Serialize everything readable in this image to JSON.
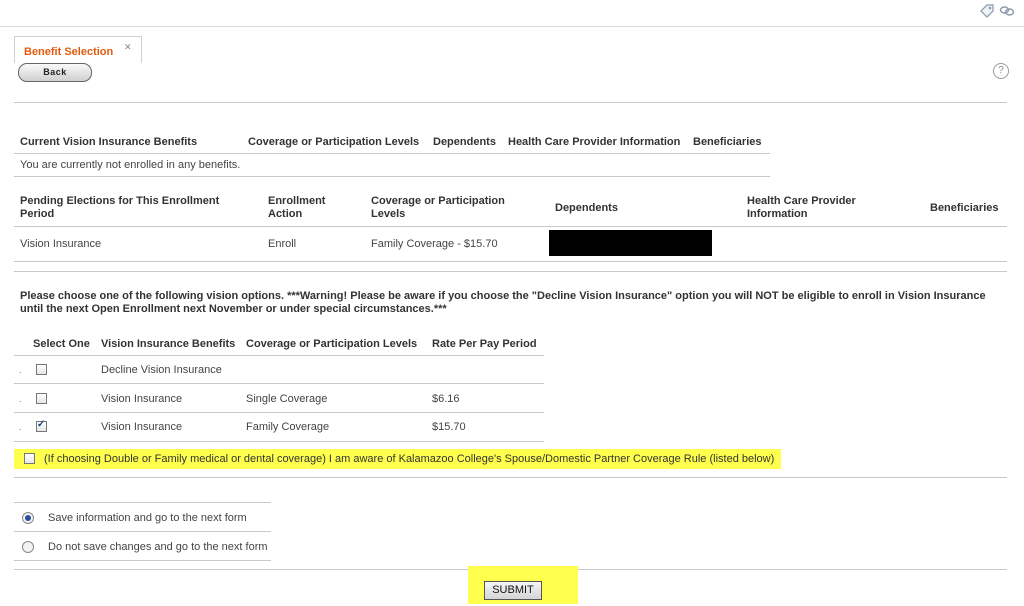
{
  "tab": {
    "title": "Benefit Selection"
  },
  "toolbar": {
    "back_label": "Back",
    "help_label": "?"
  },
  "current": {
    "headers": [
      "Current Vision Insurance Benefits",
      "Coverage or Participation Levels",
      "Dependents",
      "Health Care Provider Information",
      "Beneficiaries"
    ],
    "message": "You are currently not enrolled in any benefits."
  },
  "pending": {
    "headers": [
      "Pending Elections for This Enrollment Period",
      "Enrollment Action",
      "Coverage or Participation Levels",
      "Dependents",
      "Health Care Provider Information",
      "Beneficiaries"
    ],
    "row": {
      "benefit": "Vision Insurance",
      "action": "Enroll",
      "coverage": "Family Coverage - $15.70"
    }
  },
  "instructions": "Please choose one of the following vision options. ***Warning! Please be aware if you choose the \"Decline Vision Insurance\" option you will NOT be eligible to enroll in Vision Insurance until the next Open Enrollment next November or under special circumstances.***",
  "options": {
    "headers": [
      "Select One",
      "Vision Insurance Benefits",
      "Coverage or Participation Levels",
      "Rate Per Pay Period"
    ],
    "rows": [
      {
        "benefit": "Decline Vision Insurance",
        "coverage": "",
        "rate": "",
        "checked": false
      },
      {
        "benefit": "Vision Insurance",
        "coverage": "Single Coverage",
        "rate": "$6.16",
        "checked": false
      },
      {
        "benefit": "Vision Insurance",
        "coverage": "Family Coverage",
        "rate": "$15.70",
        "checked": true
      }
    ]
  },
  "acknowledgement": {
    "label": "(If choosing Double or Family medical or dental coverage) I am aware of Kalamazoo College's Spouse/Domestic Partner Coverage Rule (listed below)",
    "checked": false
  },
  "save_options": [
    {
      "label": "Save information and go to the next form",
      "selected": true
    },
    {
      "label": "Do not save changes and go to the next form",
      "selected": false
    }
  ],
  "submit_label": "SUBMIT",
  "colors": {
    "tab_title": "#e05a10",
    "highlight": "#ffff4d",
    "radio_selected": "#2a4f9e"
  },
  "icons": [
    "tag-icon",
    "link-icon",
    "close-icon",
    "help-icon",
    "checkbox-icon",
    "radio-icon"
  ]
}
